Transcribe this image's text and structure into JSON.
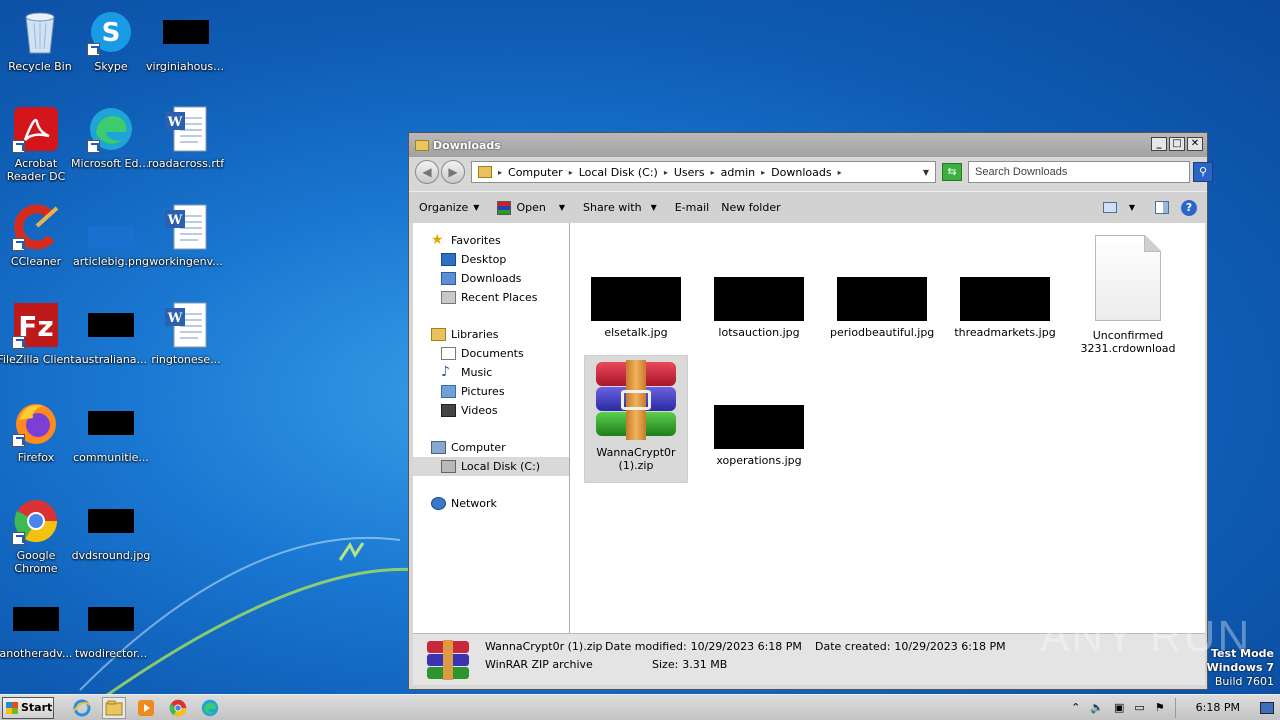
{
  "desktop": {
    "icons": [
      {
        "label": "Recycle Bin"
      },
      {
        "label": "Skype"
      },
      {
        "label": "virginiahousi..."
      },
      {
        "label": "Acrobat Reader DC"
      },
      {
        "label": "Microsoft Edge"
      },
      {
        "label": "roadacross.rtf"
      },
      {
        "label": "CCleaner"
      },
      {
        "label": "articlebig.png"
      },
      {
        "label": "workingenv..."
      },
      {
        "label": "FileZilla Client"
      },
      {
        "label": "australiana..."
      },
      {
        "label": "ringtonese..."
      },
      {
        "label": "Firefox"
      },
      {
        "label": "communitie..."
      },
      {
        "label": "Google Chrome"
      },
      {
        "label": "dvdsround.jpg"
      },
      {
        "label": "anotheradv..."
      },
      {
        "label": "twodirector..."
      }
    ]
  },
  "window": {
    "title": "Downloads",
    "breadcrumb": [
      "Computer",
      "Local Disk (C:)",
      "Users",
      "admin",
      "Downloads"
    ],
    "search_placeholder": "Search Downloads",
    "toolbar": {
      "organize": "Organize",
      "open": "Open",
      "share_with": "Share with",
      "email": "E-mail",
      "new_folder": "New folder"
    },
    "nav": {
      "favorites": "Favorites",
      "desktop": "Desktop",
      "downloads": "Downloads",
      "recent_places": "Recent Places",
      "libraries": "Libraries",
      "documents": "Documents",
      "music": "Music",
      "pictures": "Pictures",
      "videos": "Videos",
      "computer": "Computer",
      "local_disk": "Local Disk (C:)",
      "network": "Network"
    },
    "files": [
      {
        "name": "elsetalk.jpg"
      },
      {
        "name": "lotsauction.jpg"
      },
      {
        "name": "periodbeautiful.jpg"
      },
      {
        "name": "threadmarkets.jpg"
      },
      {
        "name": "Unconfirmed 3231.crdownload"
      },
      {
        "name": "WannaCrypt0r (1).zip"
      },
      {
        "name": "xoperations.jpg"
      }
    ],
    "details": {
      "filename": "WannaCrypt0r (1).zip",
      "type": "WinRAR ZIP archive",
      "date_modified_label": "Date modified:",
      "date_modified": "10/29/2023 6:18 PM",
      "size_label": "Size:",
      "size": "3.31 MB",
      "date_created_label": "Date created:",
      "date_created": "10/29/2023 6:18 PM"
    }
  },
  "watermark": "ANY RUN",
  "test_mode": {
    "line1": "Test Mode",
    "line2": "Windows 7",
    "line3": "Build 7601"
  },
  "taskbar": {
    "start": "Start",
    "clock": "6:18 PM"
  }
}
